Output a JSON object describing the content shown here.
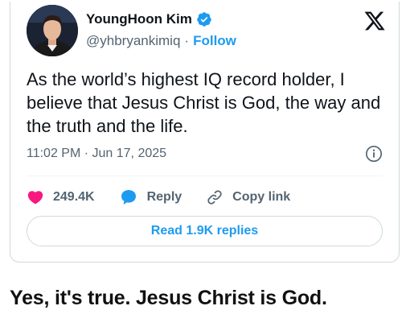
{
  "tweet": {
    "author": {
      "name": "YoungHoon Kim",
      "handle": "@yhbryankimiq",
      "separator": "·",
      "follow_label": "Follow",
      "verified": true,
      "verified_color": "#1d9bf0"
    },
    "brand_icon": "x-logo-icon",
    "text": "As the world’s highest IQ record holder, I believe that Jesus Christ is God, the way and the truth and the life.",
    "timestamp": "11:02 PM · Jun 17, 2025",
    "actions": {
      "like_count": "249.4K",
      "like_color": "#f91880",
      "reply_label": "Reply",
      "reply_color": "#1d9bf0",
      "copy_link_label": "Copy link"
    },
    "read_replies_label": "Read 1.9K replies",
    "accent_color": "#1d9bf0"
  },
  "caption": "Yes, it's true. Jesus Christ is God."
}
